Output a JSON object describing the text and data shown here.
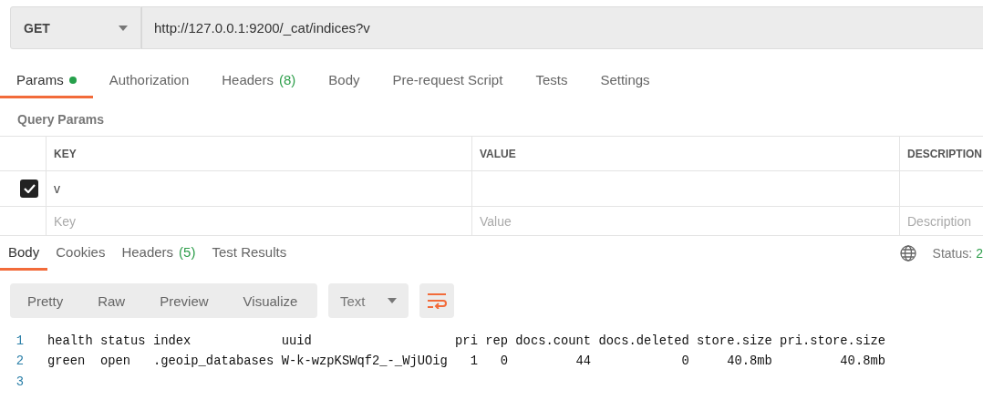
{
  "request": {
    "method": "GET",
    "url": "http://127.0.0.1:9200/_cat/indices?v"
  },
  "request_tabs": [
    {
      "label": "Params",
      "selected": true,
      "dot": true
    },
    {
      "label": "Authorization",
      "selected": false
    },
    {
      "label": "Headers",
      "count": "(8)",
      "selected": false
    },
    {
      "label": "Body",
      "selected": false
    },
    {
      "label": "Pre-request Script",
      "selected": false
    },
    {
      "label": "Tests",
      "selected": false
    },
    {
      "label": "Settings",
      "selected": false
    }
  ],
  "query_params": {
    "title": "Query Params",
    "columns": [
      "KEY",
      "VALUE",
      "DESCRIPTION"
    ],
    "rows": [
      {
        "checked": true,
        "key": "v",
        "value": "",
        "description": ""
      }
    ],
    "placeholders": {
      "key": "Key",
      "value": "Value",
      "description": "Description"
    }
  },
  "response_tabs": [
    {
      "label": "Body",
      "selected": true
    },
    {
      "label": "Cookies",
      "selected": false
    },
    {
      "label": "Headers",
      "count": "(5)",
      "selected": false
    },
    {
      "label": "Test Results",
      "selected": false
    }
  ],
  "status": {
    "label": "Status:",
    "value": "2"
  },
  "view_modes": [
    {
      "label": "Pretty",
      "selected": false
    },
    {
      "label": "Raw",
      "selected": false
    },
    {
      "label": "Preview",
      "selected": false
    },
    {
      "label": "Visualize",
      "selected": false
    }
  ],
  "format": "Text",
  "code_lines": [
    {
      "number": "1",
      "text": "health status index            uuid                   pri rep docs.count docs.deleted store.size pri.store.size"
    },
    {
      "number": "2",
      "text": "green  open   .geoip_databases W-k-wzpKSWqf2_-_WjUOig   1   0         44            0     40.8mb         40.8mb"
    },
    {
      "number": "3"
    }
  ]
}
